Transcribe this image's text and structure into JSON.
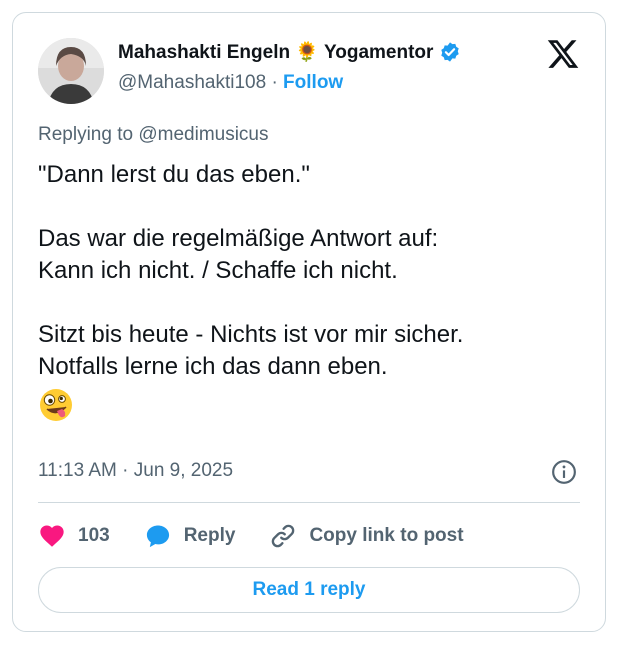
{
  "author": {
    "name": "Mahashakti Engeln 🌻 Yogamentor",
    "handle": "@Mahashakti108",
    "separator": "·",
    "follow_label": "Follow"
  },
  "reply_context": {
    "prefix": "Replying to",
    "mention": "@medimusicus"
  },
  "post": {
    "lines": [
      "\"Dann lerst du das eben.\"",
      "",
      "Das war die regelmäßige Antwort auf:",
      "Kann ich nicht. / Schaffe ich nicht.",
      "",
      "Sitzt bis heute - Nichts ist vor mir sicher.",
      "Notfalls lerne ich das dann eben."
    ],
    "emoji": "zany-face"
  },
  "meta": {
    "time": "11:13 AM",
    "separator": "·",
    "date": "Jun 9, 2025"
  },
  "actions": {
    "like_count": "103",
    "reply_label": "Reply",
    "copy_label": "Copy link to post"
  },
  "read_replies_label": "Read 1 reply",
  "colors": {
    "accent": "#1d9bf0",
    "like": "#f91880",
    "text": "#0f1419",
    "muted": "#536471",
    "border": "#cfd9de"
  }
}
